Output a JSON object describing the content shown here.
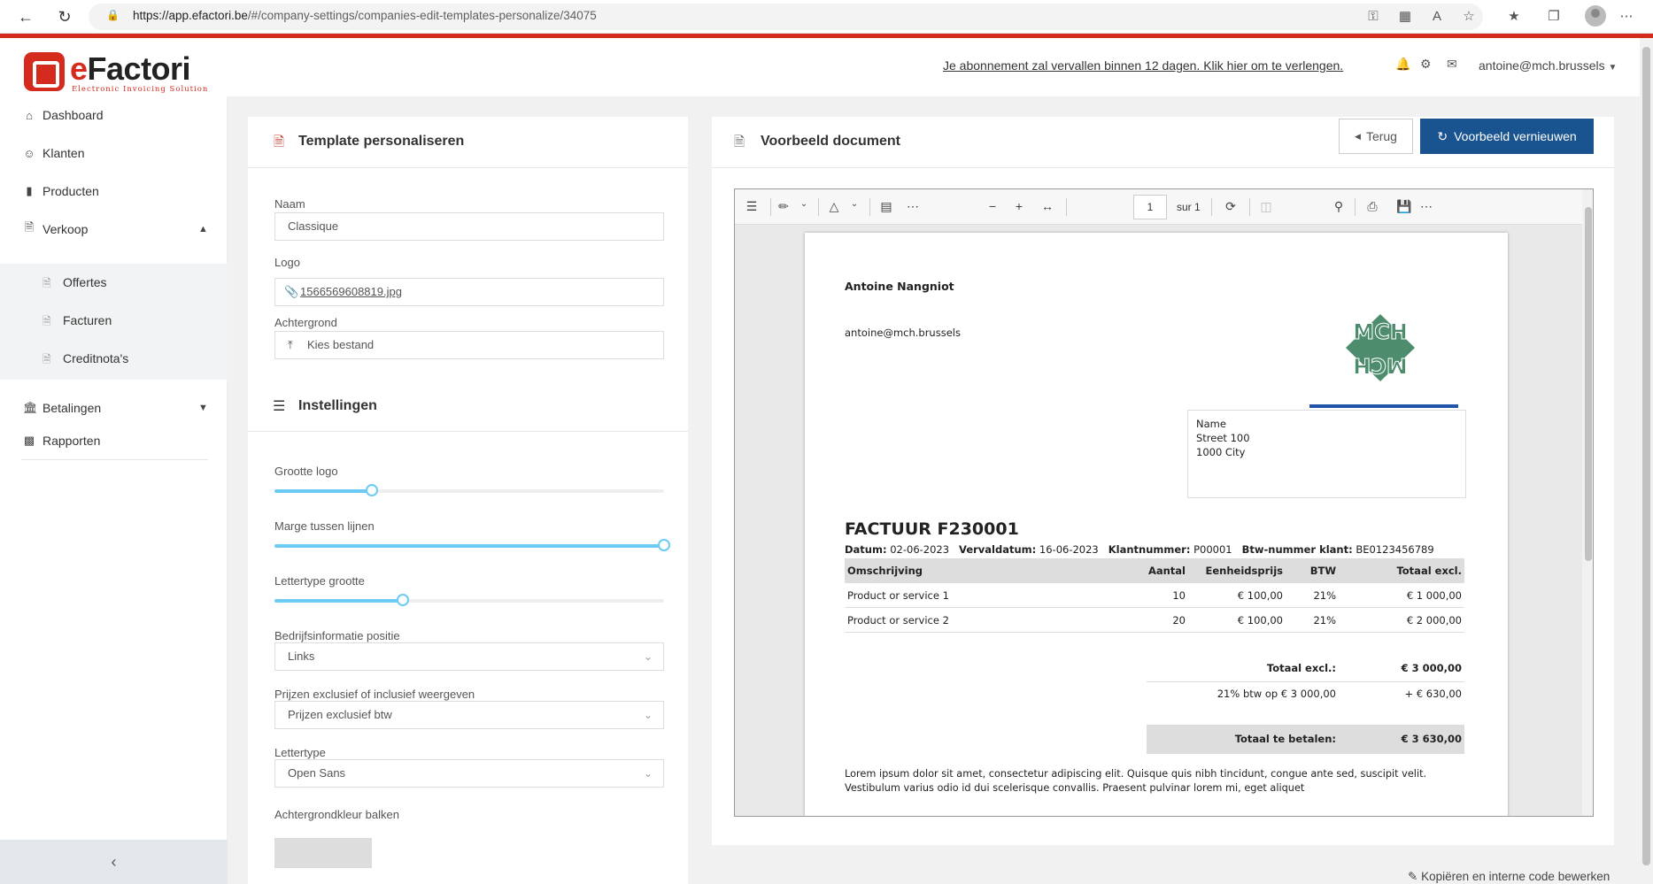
{
  "browser": {
    "url_host": "https://app.efactori.be",
    "url_path": "/#/company-settings/companies-edit-templates-personalize/34075"
  },
  "brand": {
    "name_e": "e",
    "name_rest": "Factori",
    "tagline": "Electronic Invoicing Solution",
    "accent_color": "#d52b1e"
  },
  "header": {
    "notice": "Je abonnement zal vervallen binnen 12 dagen. Klik hier om te verlengen.",
    "user": "antoine@mch.brussels"
  },
  "sidebar": {
    "items": [
      {
        "label": "Dashboard",
        "icon": "home-icon"
      },
      {
        "label": "Klanten",
        "icon": "user-icon"
      },
      {
        "label": "Producten",
        "icon": "barcode-icon"
      },
      {
        "label": "Verkoop",
        "icon": "file-pdf-icon"
      },
      {
        "label": "Betalingen",
        "icon": "bank-icon"
      },
      {
        "label": "Rapporten",
        "icon": "bar-chart-icon"
      }
    ],
    "sub_items": [
      {
        "label": "Offertes"
      },
      {
        "label": "Facturen"
      },
      {
        "label": "Creditnota's"
      }
    ]
  },
  "left_panel": {
    "title": "Template personaliseren",
    "naam_label": "Naam",
    "naam_value": "Classique",
    "logo_label": "Logo",
    "logo_value": "1566569608819.jpg",
    "achtergrond_label": "Achtergrond",
    "achtergrond_button": "Kies bestand",
    "settings_title": "Instellingen",
    "grootte_logo_label": "Grootte logo",
    "grootte_logo_level": 0.25,
    "marge_label": "Marge tussen lijnen",
    "marge_level": 1.0,
    "lettertype_grootte_label": "Lettertype grootte",
    "lettertype_grootte_level": 0.33,
    "bedrijf_label": "Bedrijfsinformatie positie",
    "bedrijf_value": "Links",
    "prijzen_label": "Prijzen exclusief of inclusief weergeven",
    "prijzen_value": "Prijzen exclusief btw",
    "lettertype_label": "Lettertype",
    "lettertype_value": "Open Sans",
    "kleur_label": "Achtergrondkleur balken",
    "kleur_value": "#dddddd"
  },
  "right_panel": {
    "title": "Voorbeeld document",
    "back_button": "Terug",
    "refresh_button": "Voorbeeld vernieuwen",
    "refresh_color": "#1a5490"
  },
  "viewer": {
    "page_number": "1",
    "page_of": "sur 1"
  },
  "invoice": {
    "company": "Antoine Nangniot",
    "email": "antoine@mch.brussels",
    "addr_name": "Name",
    "addr_street": "Street 100",
    "addr_city": "1000 City",
    "title": "FACTUUR F230001",
    "datum_label": "Datum:",
    "datum": "02-06-2023",
    "verval_label": "Vervaldatum:",
    "verval": "16-06-2023",
    "klant_label": "Klantnummer:",
    "klant": "P00001",
    "btw_label": "Btw-nummer klant:",
    "btw": "BE0123456789",
    "columns": [
      "Omschrijving",
      "Aantal",
      "Eenheidsprijs",
      "BTW",
      "Totaal excl."
    ],
    "rows": [
      {
        "desc": "Product or service 1",
        "qty": "10",
        "unit": "€ 100,00",
        "vat": "21%",
        "total": "€ 1 000,00"
      },
      {
        "desc": "Product or service 2",
        "qty": "20",
        "unit": "€ 100,00",
        "vat": "21%",
        "total": "€ 2 000,00"
      }
    ],
    "tot_excl_label": "Totaal excl.:",
    "tot_excl": "€ 3 000,00",
    "vat_label": "21% btw op € 3 000,00",
    "vat_amount": "+ € 630,00",
    "tot_pay_label": "Totaal te betalen:",
    "tot_pay": "€ 3 630,00",
    "lorem1": "Lorem ipsum dolor sit amet, consectetur adipiscing elit. Quisque quis nibh tincidunt, congue ante sed, suscipit velit.",
    "lorem2": "Vestibulum varius odio id dui scelerisque convallis. Praesent pulvinar lorem mi, eget aliquet"
  },
  "footer": {
    "link": "Kopiëren en interne code bewerken"
  }
}
